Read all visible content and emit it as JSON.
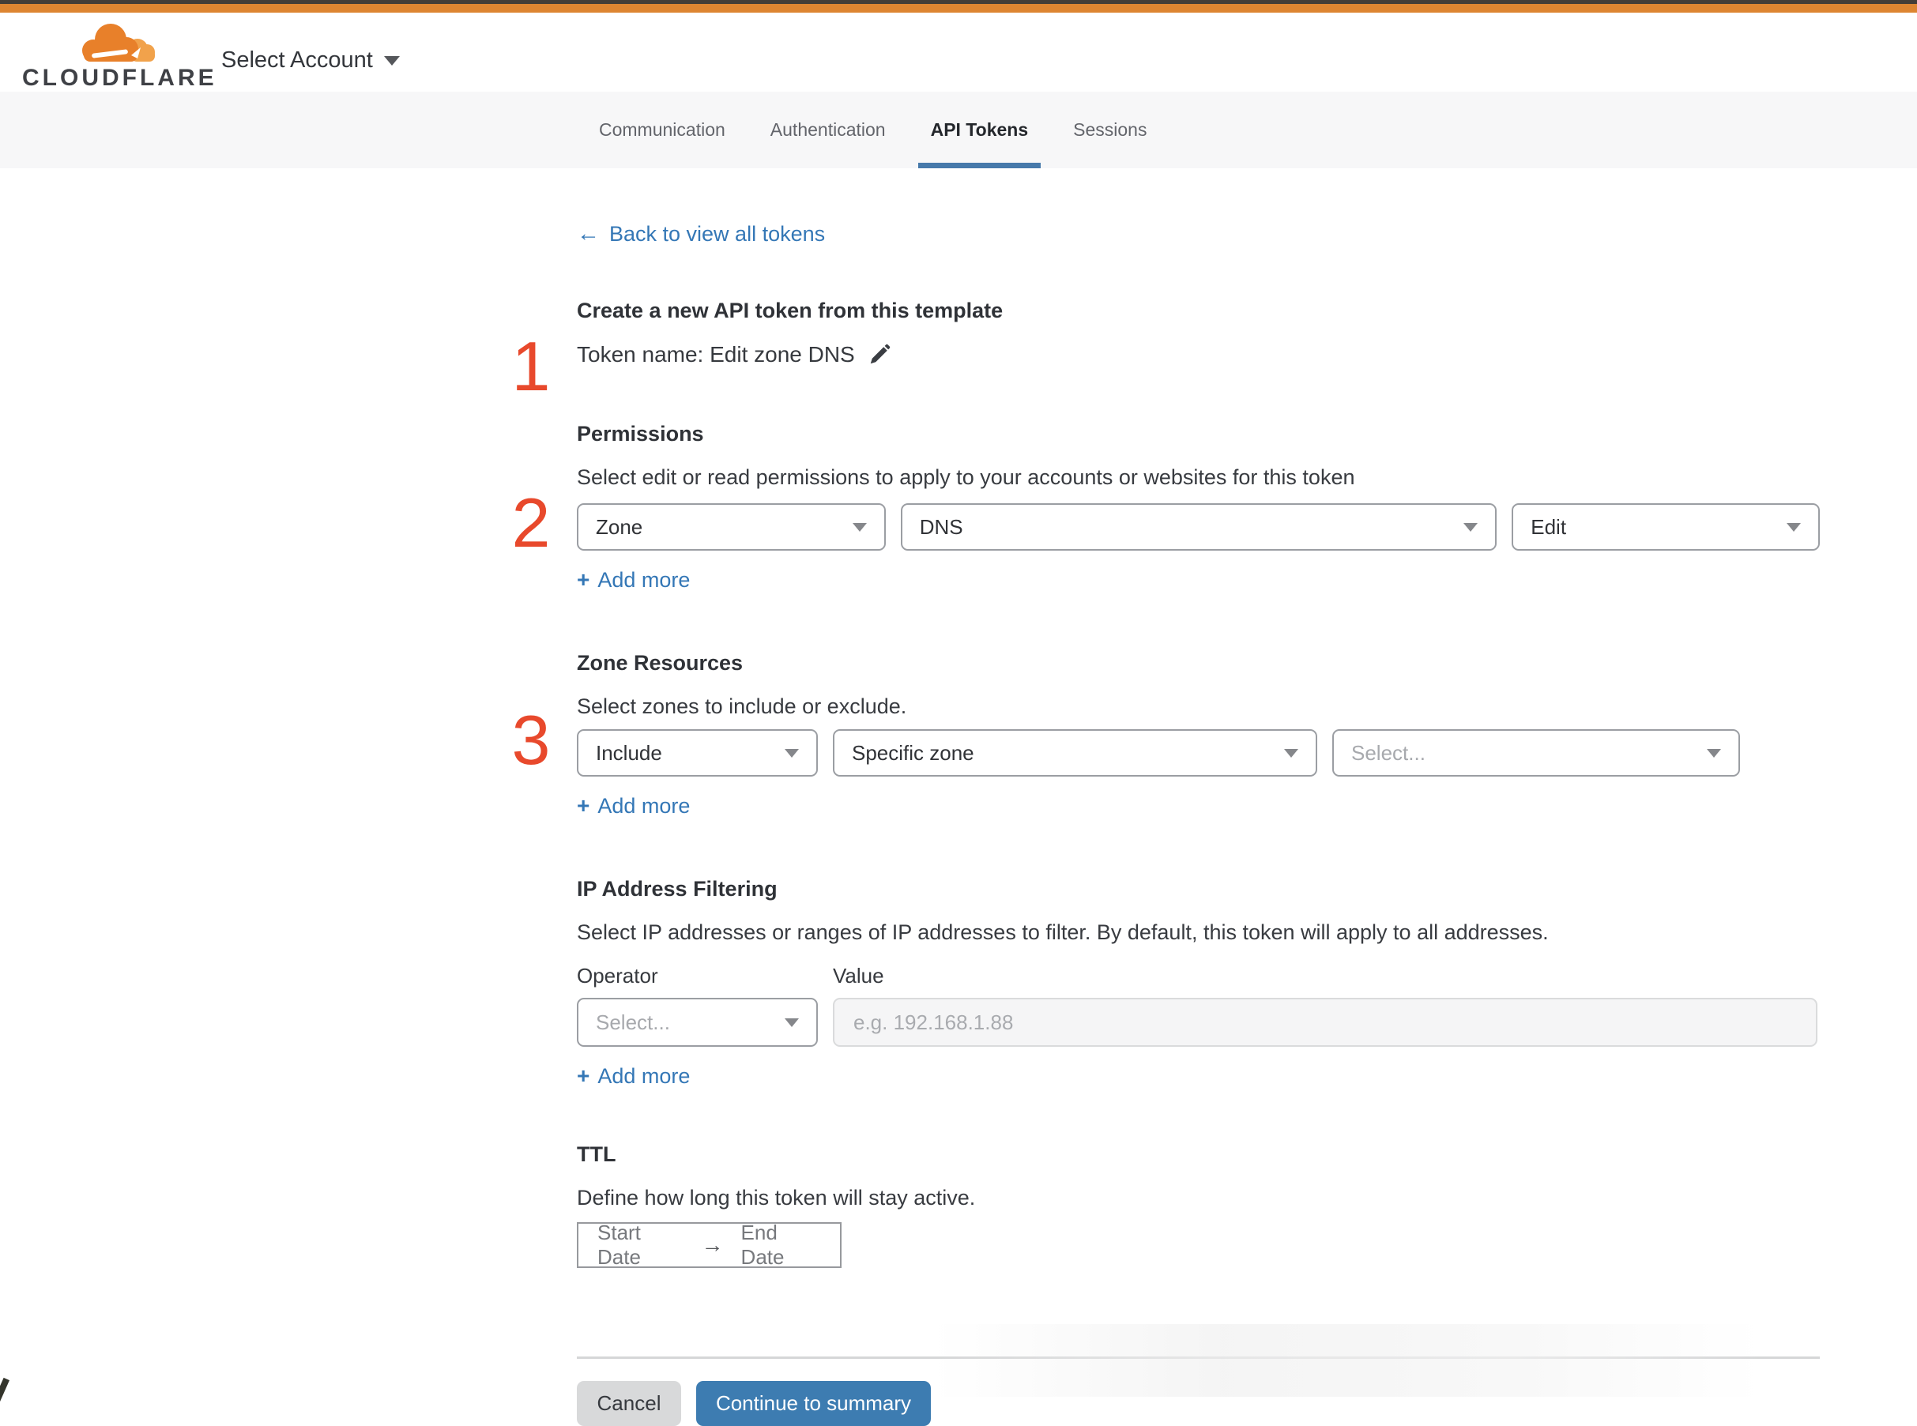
{
  "header": {
    "logo": "CLOUDFLARE",
    "account_selector_label": "Select Account"
  },
  "tabs": {
    "communication": "Communication",
    "authentication": "Authentication",
    "api_tokens": "API Tokens",
    "sessions": "Sessions"
  },
  "back_link": {
    "arrow": "←",
    "label": "Back to view all tokens"
  },
  "annotations": {
    "one": "1",
    "two": "2",
    "three": "3"
  },
  "template_section": {
    "heading": "Create a new API token from this template",
    "token_name": "Token name: Edit zone DNS"
  },
  "permissions": {
    "heading": "Permissions",
    "description": "Select edit or read permissions to apply to your accounts or websites for this token",
    "scope_value": "Zone",
    "resource_value": "DNS",
    "access_value": "Edit",
    "add_more_plus": "+",
    "add_more": "Add more"
  },
  "zone_resources": {
    "heading": "Zone Resources",
    "description": "Select zones to include or exclude.",
    "mode_value": "Include",
    "type_value": "Specific zone",
    "zone_placeholder": "Select...",
    "add_more_plus": "+",
    "add_more": "Add more"
  },
  "ip_filtering": {
    "heading": "IP Address Filtering",
    "description": "Select IP addresses or ranges of IP addresses to filter. By default, this token will apply to all addresses.",
    "operator_label": "Operator",
    "value_label": "Value",
    "operator_placeholder": "Select...",
    "value_placeholder": "e.g. 192.168.1.88",
    "add_more_plus": "+",
    "add_more": "Add more"
  },
  "ttl": {
    "heading": "TTL",
    "description": "Define how long this token will stay active.",
    "start_label": "Start Date",
    "arrow": "→",
    "end_label": "End Date"
  },
  "footer": {
    "cancel_label": "Cancel",
    "continue_label": "Continue to summary"
  },
  "colors": {
    "brand_orange": "#dd8531",
    "accent_blue": "#3d7cb1",
    "link_blue": "#3477b6",
    "tab_underline_blue": "#4679aa",
    "annotation_red": "#e8492c"
  }
}
